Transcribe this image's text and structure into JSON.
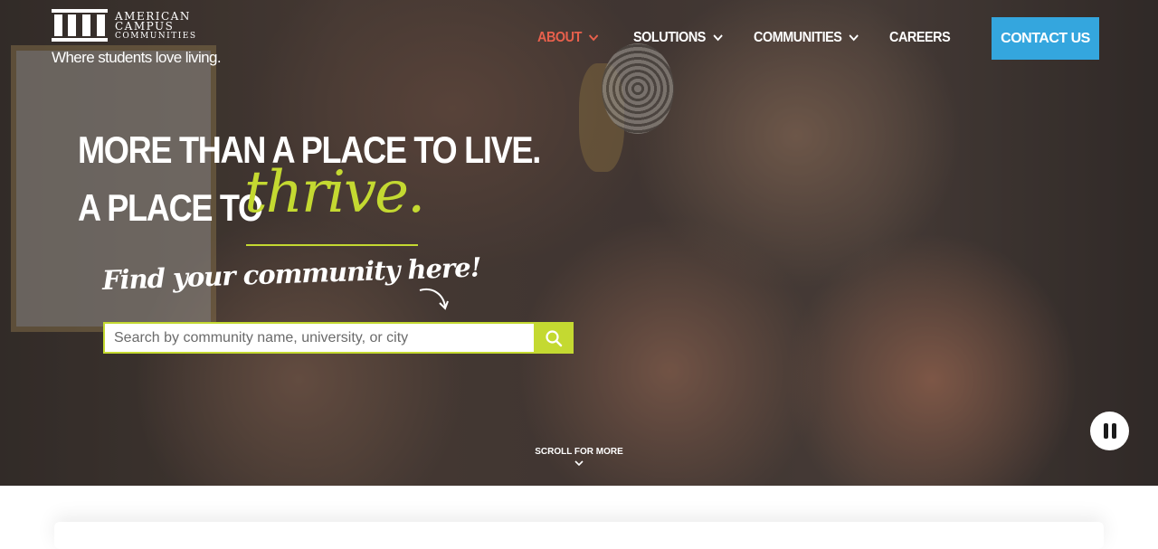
{
  "brand": {
    "name_lines": [
      "AMERICAN",
      "CAMPUS",
      "COMMUNITIES"
    ],
    "tagline": "Where students love living.",
    "logo_icon": "columns-logo-icon"
  },
  "nav": {
    "items": [
      {
        "label": "ABOUT",
        "has_dropdown": true,
        "active": true
      },
      {
        "label": "SOLUTIONS",
        "has_dropdown": true,
        "active": false
      },
      {
        "label": "COMMUNITIES",
        "has_dropdown": true,
        "active": false
      },
      {
        "label": "CAREERS",
        "has_dropdown": false,
        "active": false
      }
    ],
    "contact_label": "CONTACT US"
  },
  "hero": {
    "headline_line1": "MORE THAN A PLACE TO LIVE.",
    "headline_line2_prefix": "A PLACE TO",
    "headline_script": "thrive.",
    "find_text": "Find your community here!",
    "search_placeholder": "Search by community name, university, or city",
    "search_icon": "search-icon",
    "scroll_label": "SCROLL FOR MORE",
    "pause_icon": "pause-icon"
  },
  "colors": {
    "accent_lime": "#c4d931",
    "contact_blue": "#34a6de",
    "active_nav": "#e8604c"
  }
}
